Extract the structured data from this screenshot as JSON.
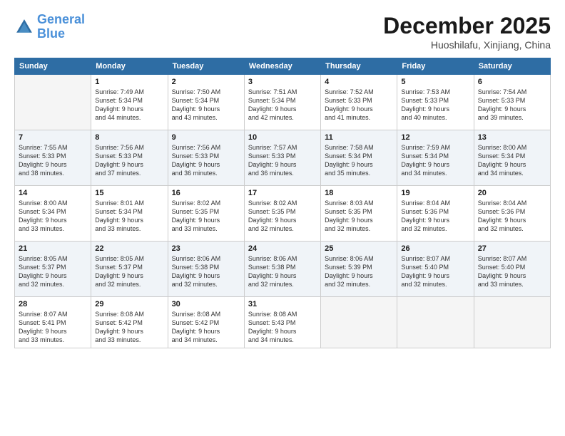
{
  "header": {
    "logo_line1": "General",
    "logo_line2": "Blue",
    "month": "December 2025",
    "location": "Huoshilafu, Xinjiang, China"
  },
  "weekdays": [
    "Sunday",
    "Monday",
    "Tuesday",
    "Wednesday",
    "Thursday",
    "Friday",
    "Saturday"
  ],
  "weeks": [
    [
      {
        "day": "",
        "sunrise": "",
        "sunset": "",
        "daylight": ""
      },
      {
        "day": "1",
        "sunrise": "Sunrise: 7:49 AM",
        "sunset": "Sunset: 5:34 PM",
        "daylight": "Daylight: 9 hours and 44 minutes."
      },
      {
        "day": "2",
        "sunrise": "Sunrise: 7:50 AM",
        "sunset": "Sunset: 5:34 PM",
        "daylight": "Daylight: 9 hours and 43 minutes."
      },
      {
        "day": "3",
        "sunrise": "Sunrise: 7:51 AM",
        "sunset": "Sunset: 5:34 PM",
        "daylight": "Daylight: 9 hours and 42 minutes."
      },
      {
        "day": "4",
        "sunrise": "Sunrise: 7:52 AM",
        "sunset": "Sunset: 5:33 PM",
        "daylight": "Daylight: 9 hours and 41 minutes."
      },
      {
        "day": "5",
        "sunrise": "Sunrise: 7:53 AM",
        "sunset": "Sunset: 5:33 PM",
        "daylight": "Daylight: 9 hours and 40 minutes."
      },
      {
        "day": "6",
        "sunrise": "Sunrise: 7:54 AM",
        "sunset": "Sunset: 5:33 PM",
        "daylight": "Daylight: 9 hours and 39 minutes."
      }
    ],
    [
      {
        "day": "7",
        "sunrise": "Sunrise: 7:55 AM",
        "sunset": "Sunset: 5:33 PM",
        "daylight": "Daylight: 9 hours and 38 minutes."
      },
      {
        "day": "8",
        "sunrise": "Sunrise: 7:56 AM",
        "sunset": "Sunset: 5:33 PM",
        "daylight": "Daylight: 9 hours and 37 minutes."
      },
      {
        "day": "9",
        "sunrise": "Sunrise: 7:56 AM",
        "sunset": "Sunset: 5:33 PM",
        "daylight": "Daylight: 9 hours and 36 minutes."
      },
      {
        "day": "10",
        "sunrise": "Sunrise: 7:57 AM",
        "sunset": "Sunset: 5:33 PM",
        "daylight": "Daylight: 9 hours and 36 minutes."
      },
      {
        "day": "11",
        "sunrise": "Sunrise: 7:58 AM",
        "sunset": "Sunset: 5:34 PM",
        "daylight": "Daylight: 9 hours and 35 minutes."
      },
      {
        "day": "12",
        "sunrise": "Sunrise: 7:59 AM",
        "sunset": "Sunset: 5:34 PM",
        "daylight": "Daylight: 9 hours and 34 minutes."
      },
      {
        "day": "13",
        "sunrise": "Sunrise: 8:00 AM",
        "sunset": "Sunset: 5:34 PM",
        "daylight": "Daylight: 9 hours and 34 minutes."
      }
    ],
    [
      {
        "day": "14",
        "sunrise": "Sunrise: 8:00 AM",
        "sunset": "Sunset: 5:34 PM",
        "daylight": "Daylight: 9 hours and 33 minutes."
      },
      {
        "day": "15",
        "sunrise": "Sunrise: 8:01 AM",
        "sunset": "Sunset: 5:34 PM",
        "daylight": "Daylight: 9 hours and 33 minutes."
      },
      {
        "day": "16",
        "sunrise": "Sunrise: 8:02 AM",
        "sunset": "Sunset: 5:35 PM",
        "daylight": "Daylight: 9 hours and 33 minutes."
      },
      {
        "day": "17",
        "sunrise": "Sunrise: 8:02 AM",
        "sunset": "Sunset: 5:35 PM",
        "daylight": "Daylight: 9 hours and 32 minutes."
      },
      {
        "day": "18",
        "sunrise": "Sunrise: 8:03 AM",
        "sunset": "Sunset: 5:35 PM",
        "daylight": "Daylight: 9 hours and 32 minutes."
      },
      {
        "day": "19",
        "sunrise": "Sunrise: 8:04 AM",
        "sunset": "Sunset: 5:36 PM",
        "daylight": "Daylight: 9 hours and 32 minutes."
      },
      {
        "day": "20",
        "sunrise": "Sunrise: 8:04 AM",
        "sunset": "Sunset: 5:36 PM",
        "daylight": "Daylight: 9 hours and 32 minutes."
      }
    ],
    [
      {
        "day": "21",
        "sunrise": "Sunrise: 8:05 AM",
        "sunset": "Sunset: 5:37 PM",
        "daylight": "Daylight: 9 hours and 32 minutes."
      },
      {
        "day": "22",
        "sunrise": "Sunrise: 8:05 AM",
        "sunset": "Sunset: 5:37 PM",
        "daylight": "Daylight: 9 hours and 32 minutes."
      },
      {
        "day": "23",
        "sunrise": "Sunrise: 8:06 AM",
        "sunset": "Sunset: 5:38 PM",
        "daylight": "Daylight: 9 hours and 32 minutes."
      },
      {
        "day": "24",
        "sunrise": "Sunrise: 8:06 AM",
        "sunset": "Sunset: 5:38 PM",
        "daylight": "Daylight: 9 hours and 32 minutes."
      },
      {
        "day": "25",
        "sunrise": "Sunrise: 8:06 AM",
        "sunset": "Sunset: 5:39 PM",
        "daylight": "Daylight: 9 hours and 32 minutes."
      },
      {
        "day": "26",
        "sunrise": "Sunrise: 8:07 AM",
        "sunset": "Sunset: 5:40 PM",
        "daylight": "Daylight: 9 hours and 32 minutes."
      },
      {
        "day": "27",
        "sunrise": "Sunrise: 8:07 AM",
        "sunset": "Sunset: 5:40 PM",
        "daylight": "Daylight: 9 hours and 33 minutes."
      }
    ],
    [
      {
        "day": "28",
        "sunrise": "Sunrise: 8:07 AM",
        "sunset": "Sunset: 5:41 PM",
        "daylight": "Daylight: 9 hours and 33 minutes."
      },
      {
        "day": "29",
        "sunrise": "Sunrise: 8:08 AM",
        "sunset": "Sunset: 5:42 PM",
        "daylight": "Daylight: 9 hours and 33 minutes."
      },
      {
        "day": "30",
        "sunrise": "Sunrise: 8:08 AM",
        "sunset": "Sunset: 5:42 PM",
        "daylight": "Daylight: 9 hours and 34 minutes."
      },
      {
        "day": "31",
        "sunrise": "Sunrise: 8:08 AM",
        "sunset": "Sunset: 5:43 PM",
        "daylight": "Daylight: 9 hours and 34 minutes."
      },
      {
        "day": "",
        "sunrise": "",
        "sunset": "",
        "daylight": ""
      },
      {
        "day": "",
        "sunrise": "",
        "sunset": "",
        "daylight": ""
      },
      {
        "day": "",
        "sunrise": "",
        "sunset": "",
        "daylight": ""
      }
    ]
  ]
}
